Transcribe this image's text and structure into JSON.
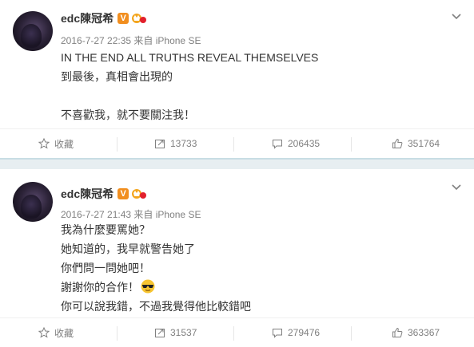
{
  "posts": [
    {
      "user": "edc陳冠希",
      "meta": "2016-7-27 22:35 来自 iPhone SE",
      "lines": [
        "IN THE END ALL TRUTHS REVEAL THEMSELVES",
        "到最後，真相會出現的",
        "",
        "不喜歡我，就不要關注我！"
      ],
      "actions": {
        "favorite": "收藏",
        "repost": "13733",
        "comment": "206435",
        "like": "351764"
      }
    },
    {
      "user": "edc陳冠希",
      "meta": "2016-7-27 21:43 来自 iPhone SE",
      "lines": [
        "我為什麼要罵她？",
        "她知道的，我早就警告她了",
        "你們問一問她吧！",
        "謝謝你的合作！",
        "你可以說我錯，不過我覺得他比較錯吧"
      ],
      "actions": {
        "favorite": "收藏",
        "repost": "31537",
        "comment": "279476",
        "like": "363367"
      }
    }
  ],
  "icons": {
    "verified": "V",
    "crown": "crown-badge-icon",
    "chevron": "chevron-down-icon",
    "favorite": "star-icon",
    "repost": "repost-icon",
    "comment": "comment-icon",
    "like": "thumbs-up-icon",
    "emoji": "sunglasses-emoji-icon"
  },
  "colors": {
    "verified": "#f18e1f",
    "divider": "#e7eef1",
    "meta": "#808080"
  }
}
